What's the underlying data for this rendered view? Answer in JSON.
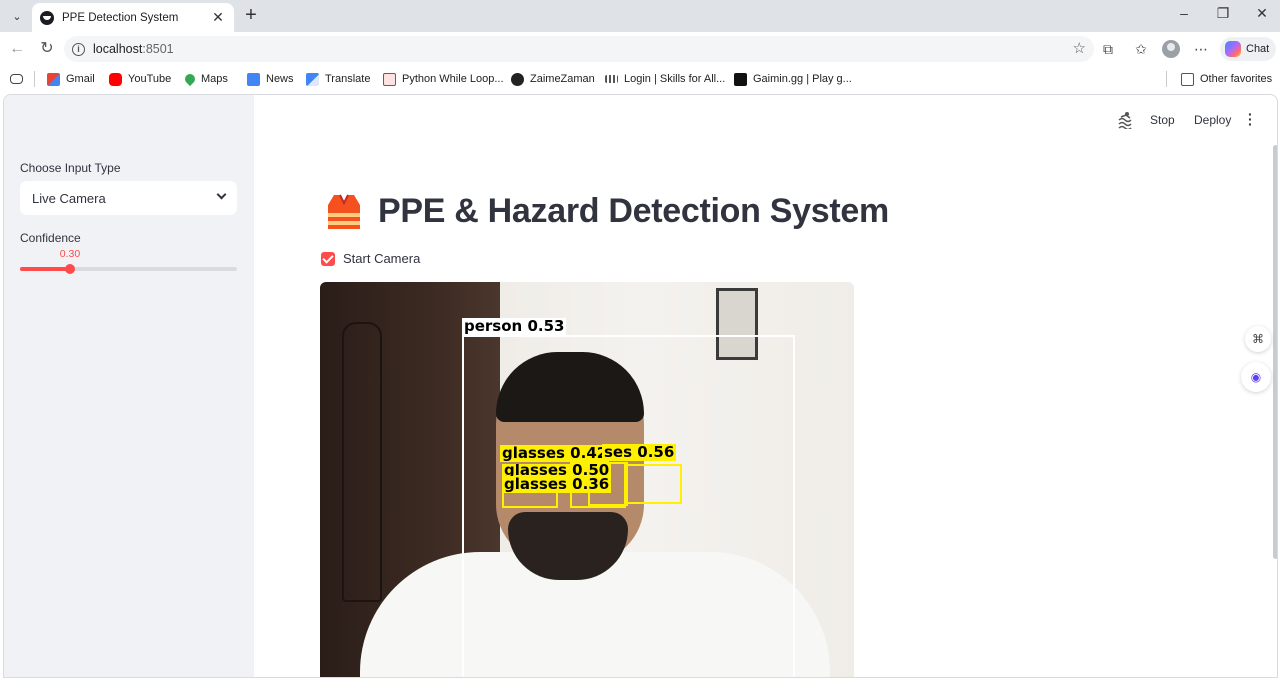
{
  "browser": {
    "tab_title": "PPE Detection System",
    "url_host": "localhost",
    "url_port": ":8501",
    "chat_label": "Chat",
    "bookmarks": [
      {
        "label": "Gmail",
        "icon": "gmail-icon",
        "color": "#ea4335"
      },
      {
        "label": "YouTube",
        "icon": "youtube-icon",
        "color": "#ff0000"
      },
      {
        "label": "Maps",
        "icon": "maps-icon",
        "color": "#34a853"
      },
      {
        "label": "News",
        "icon": "news-icon",
        "color": "#4285f4"
      },
      {
        "label": "Translate",
        "icon": "translate-icon",
        "color": "#4285f4"
      },
      {
        "label": "Python While Loop...",
        "icon": "python-icon",
        "color": "#c0392b"
      },
      {
        "label": "ZaimeZaman",
        "icon": "github-icon",
        "color": "#222222"
      },
      {
        "label": "Login | Skills for All...",
        "icon": "cisco-icon",
        "color": "#555555"
      },
      {
        "label": "Gaimin.gg | Play g...",
        "icon": "gaimin-icon",
        "color": "#111111"
      }
    ],
    "other_favorites": "Other favorites"
  },
  "sidebar": {
    "input_type_label": "Choose Input Type",
    "input_type_value": "Live Camera",
    "confidence_label": "Confidence",
    "confidence_value": "0.30",
    "confidence_fraction": 0.3
  },
  "header": {
    "stop_label": "Stop",
    "deploy_label": "Deploy"
  },
  "main": {
    "title": "PPE & Hazard Detection System",
    "checkbox_label": "Start Camera",
    "checkbox_checked": true
  },
  "detections": [
    {
      "label": "person 0.53",
      "style": "white"
    },
    {
      "label": "glasses 0.42",
      "style": "yellow"
    },
    {
      "label": "ses 0.56",
      "style": "yellow"
    },
    {
      "label": "glasses 0.50",
      "style": "yellow"
    },
    {
      "label": "glasses 0.36",
      "style": "yellow"
    }
  ],
  "colors": {
    "accent": "#ff4b4b",
    "sidebar_bg": "#f0f2f6",
    "text": "#31333f",
    "bbox_person": "#ffffff",
    "bbox_glasses": "#ffef00"
  }
}
